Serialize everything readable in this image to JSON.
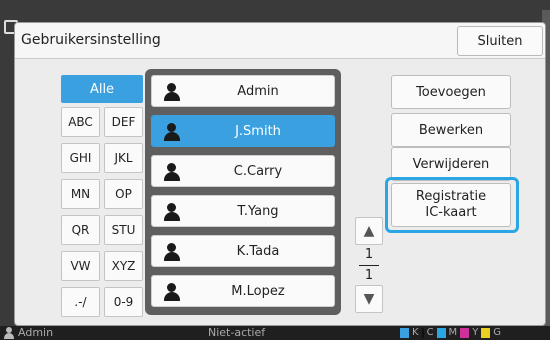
{
  "dialog": {
    "title": "Gebruikersinstelling",
    "close_label": "Sluiten"
  },
  "filters": [
    "Alle",
    "ABC",
    "DEF",
    "GHI",
    "JKL",
    "MN",
    "OP",
    "QR",
    "STU",
    "VW",
    "XYZ",
    ".-/",
    "0-9"
  ],
  "selected_filter": "Alle",
  "users": [
    {
      "name": "Admin",
      "selected": false
    },
    {
      "name": "J.Smith",
      "selected": true
    },
    {
      "name": "C.Carry",
      "selected": false
    },
    {
      "name": "T.Yang",
      "selected": false
    },
    {
      "name": "K.Tada",
      "selected": false
    },
    {
      "name": "M.Lopez",
      "selected": false
    }
  ],
  "pager": {
    "current": "1",
    "total": "1",
    "up_icon": "▲",
    "down_icon": "▼"
  },
  "actions": {
    "add": "Toevoegen",
    "edit": "Bewerken",
    "delete": "Verwijderen",
    "ic_line1": "Registratie",
    "ic_line2": "IC-kaart"
  },
  "statusbar": {
    "user": "Admin",
    "state": "Niet-actief",
    "inks": [
      "K",
      "C",
      "M",
      "Y",
      "G"
    ]
  },
  "colors": {
    "accent": "#3aa0e0",
    "highlight": "#2aa6e2"
  }
}
